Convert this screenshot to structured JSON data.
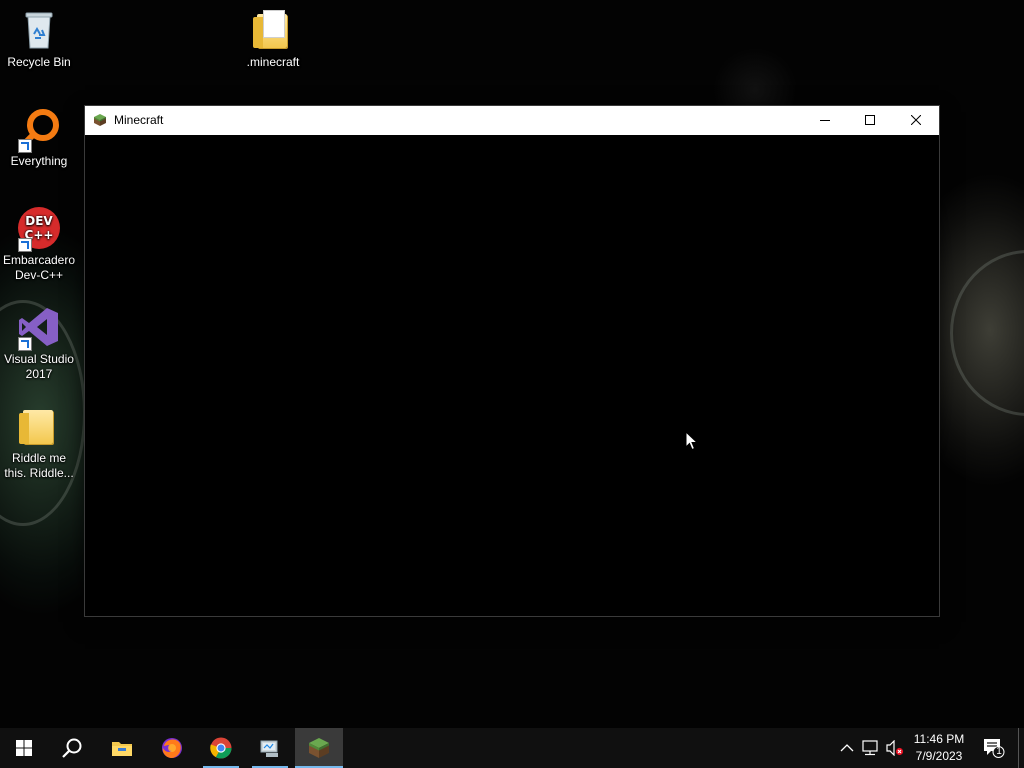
{
  "desktop": {
    "icons": [
      {
        "label": "Recycle Bin",
        "icon": "recycle-bin-icon"
      },
      {
        "label": ".minecraft",
        "icon": "folder-icon"
      },
      {
        "label": "Everything",
        "icon": "everything-search-icon"
      },
      {
        "label": "Embarcadero Dev-C++",
        "icon": "devcpp-icon",
        "glyph_text": "DEV C++"
      },
      {
        "label": "Visual Studio 2017",
        "icon": "visual-studio-icon"
      },
      {
        "label": "Riddle me this. Riddle...",
        "icon": "folder-icon"
      }
    ]
  },
  "window": {
    "title": "Minecraft",
    "icon": "minecraft-grass-block-icon",
    "controls": [
      "minimize",
      "maximize",
      "close"
    ]
  },
  "taskbar": {
    "start": "windows-start-icon",
    "search": "search-icon",
    "pinned": [
      {
        "name": "File Explorer",
        "icon": "file-explorer-icon",
        "running": false
      },
      {
        "name": "Firefox",
        "icon": "firefox-icon",
        "running": false
      },
      {
        "name": "Google Chrome",
        "icon": "chrome-icon",
        "running": true
      },
      {
        "name": "Remote/Network app",
        "icon": "network-app-icon",
        "running": true
      },
      {
        "name": "Minecraft",
        "icon": "minecraft-grass-block-icon",
        "running": true,
        "active": true
      }
    ],
    "tray": {
      "icons": [
        "chevron-up-icon",
        "network-icon",
        "volume-muted-icon"
      ],
      "time": "11:46 PM",
      "date": "7/9/2023",
      "notification_count": "1"
    }
  },
  "colors": {
    "taskbar_bg": "#101010",
    "titlebar_bg": "#ffffff",
    "accent_underline": "#76b9ed"
  }
}
